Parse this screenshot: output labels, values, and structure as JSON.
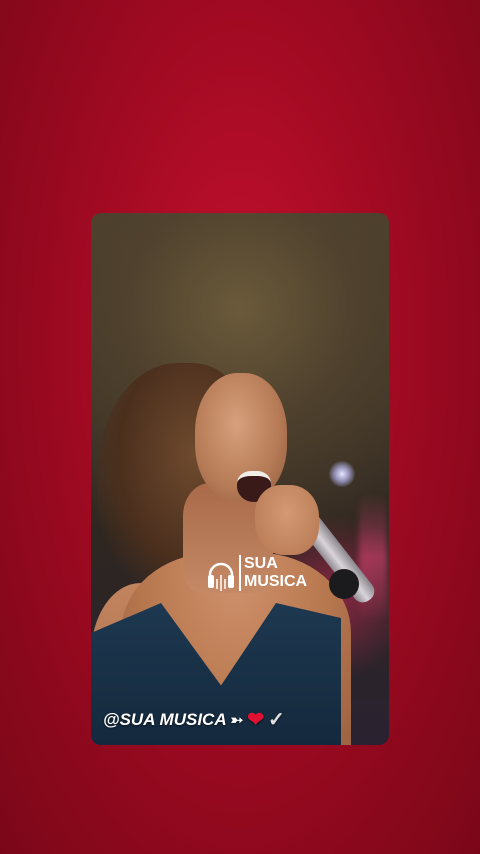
{
  "story": {
    "logo": {
      "line1": "SUA",
      "line2": "MUSICA",
      "icon": "headphones-icon"
    },
    "caption": {
      "text": "@SUA MUSICA",
      "icons": [
        "arrow-right-icon",
        "heart-icon",
        "check-icon"
      ]
    }
  },
  "colors": {
    "background": "#a10a22",
    "heart": "#e01030"
  }
}
